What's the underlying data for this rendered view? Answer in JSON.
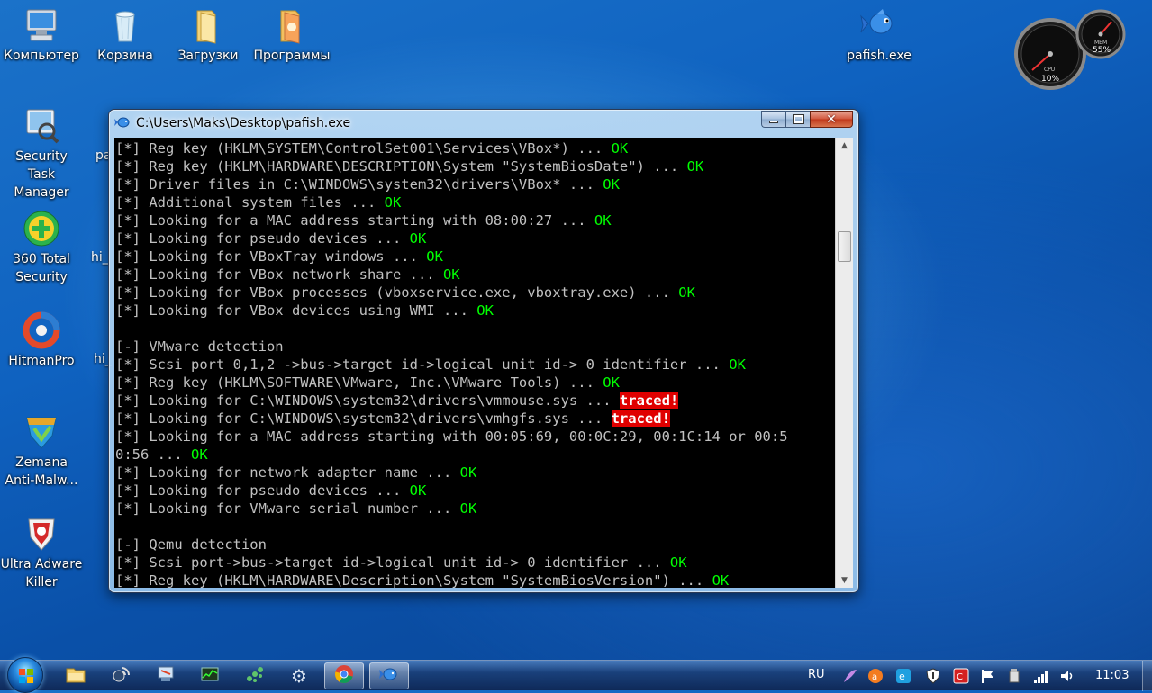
{
  "desktop": {
    "icons": [
      {
        "label": "Компьютер"
      },
      {
        "label": "Корзина"
      },
      {
        "label": "Загрузки"
      },
      {
        "label": "Программы"
      },
      {
        "label": "pafish.exe"
      },
      {
        "label": "Security Task Manager"
      },
      {
        "label": "360 Total Security"
      },
      {
        "label": "HitmanPro"
      },
      {
        "label": "Zemana Anti-Malw..."
      },
      {
        "label": "Ultra Adware Killer"
      }
    ],
    "partial_labels": [
      "pa",
      "hi_",
      "hi_"
    ],
    "gadget": {
      "cpu_label": "CPU",
      "cpu_value": "10%",
      "mem_label": "MEM",
      "mem_value": "55%"
    }
  },
  "window": {
    "title": "C:\\Users\\Maks\\Desktop\\pafish.exe",
    "minimize_icon": "minimize-icon",
    "maximize_icon": "maximize-icon",
    "close_icon": "close-icon",
    "console_lines": [
      {
        "text": "[*] Reg key (HKLM\\SYSTEM\\ControlSet001\\Services\\VBox*) ... ",
        "status": "OK",
        "kind": "ok"
      },
      {
        "text": "[*] Reg key (HKLM\\HARDWARE\\DESCRIPTION\\System \"SystemBiosDate\") ... ",
        "status": "OK",
        "kind": "ok"
      },
      {
        "text": "[*] Driver files in C:\\WINDOWS\\system32\\drivers\\VBox* ... ",
        "status": "OK",
        "kind": "ok"
      },
      {
        "text": "[*] Additional system files ... ",
        "status": "OK",
        "kind": "ok"
      },
      {
        "text": "[*] Looking for a MAC address starting with 08:00:27 ... ",
        "status": "OK",
        "kind": "ok"
      },
      {
        "text": "[*] Looking for pseudo devices ... ",
        "status": "OK",
        "kind": "ok"
      },
      {
        "text": "[*] Looking for VBoxTray windows ... ",
        "status": "OK",
        "kind": "ok"
      },
      {
        "text": "[*] Looking for VBox network share ... ",
        "status": "OK",
        "kind": "ok"
      },
      {
        "text": "[*] Looking for VBox processes (vboxservice.exe, vboxtray.exe) ... ",
        "status": "OK",
        "kind": "ok"
      },
      {
        "text": "[*] Looking for VBox devices using WMI ... ",
        "status": "OK",
        "kind": "ok"
      },
      {
        "text": "",
        "status": "",
        "kind": "blank"
      },
      {
        "text": "[-] VMware detection",
        "status": "",
        "kind": "header"
      },
      {
        "text": "[*] Scsi port 0,1,2 ->bus->target id->logical unit id-> 0 identifier ... ",
        "status": "OK",
        "kind": "ok"
      },
      {
        "text": "[*] Reg key (HKLM\\SOFTWARE\\VMware, Inc.\\VMware Tools) ... ",
        "status": "OK",
        "kind": "ok"
      },
      {
        "text": "[*] Looking for C:\\WINDOWS\\system32\\drivers\\vmmouse.sys ... ",
        "status": "traced!",
        "kind": "traced"
      },
      {
        "text": "[*] Looking for C:\\WINDOWS\\system32\\drivers\\vmhgfs.sys ... ",
        "status": "traced!",
        "kind": "traced"
      },
      {
        "text": "[*] Looking for a MAC address starting with 00:05:69, 00:0C:29, 00:1C:14 or 00:5",
        "status": "",
        "kind": "header"
      },
      {
        "text": "0:56 ... ",
        "status": "OK",
        "kind": "ok"
      },
      {
        "text": "[*] Looking for network adapter name ... ",
        "status": "OK",
        "kind": "ok"
      },
      {
        "text": "[*] Looking for pseudo devices ... ",
        "status": "OK",
        "kind": "ok"
      },
      {
        "text": "[*] Looking for VMware serial number ... ",
        "status": "OK",
        "kind": "ok"
      },
      {
        "text": "",
        "status": "",
        "kind": "blank"
      },
      {
        "text": "[-] Qemu detection",
        "status": "",
        "kind": "header"
      },
      {
        "text": "[*] Scsi port->bus->target id->logical unit id-> 0 identifier ... ",
        "status": "OK",
        "kind": "ok"
      },
      {
        "text": "[*] Reg key (HKLM\\HARDWARE\\Description\\System \"SystemBiosVersion\") ... ",
        "status": "OK",
        "kind": "ok"
      }
    ]
  },
  "taskbar": {
    "pinned": [
      "explorer-icon",
      "network-icon",
      "control-panel-icon",
      "task-manager-icon",
      "gadget-icon",
      "settings-icon",
      "chrome-icon",
      "pafish-icon"
    ],
    "tray": {
      "language": "RU",
      "clock": "11:03"
    },
    "colors": {
      "ok": "#00ff00",
      "traced_bg": "#e00000"
    }
  }
}
